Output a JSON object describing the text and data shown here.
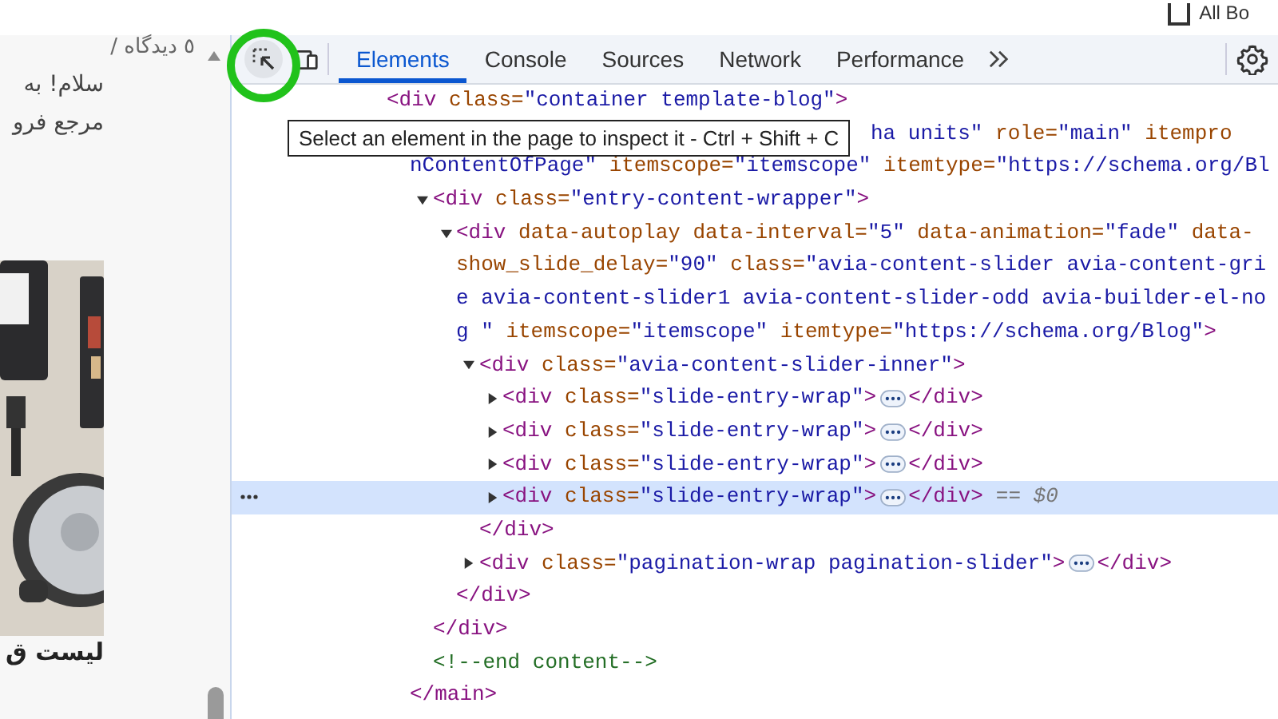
{
  "top_bar": {
    "checkbox": {
      "label": "All Bo",
      "checked": false
    }
  },
  "page": {
    "meta": "٥ دیدگاه /",
    "lines": [
      "سلام! به",
      "مرجع فرو"
    ],
    "heading": "لیست ق"
  },
  "devtools": {
    "tabs": [
      {
        "label": "Elements",
        "selected": true
      },
      {
        "label": "Console",
        "selected": false
      },
      {
        "label": "Sources",
        "selected": false
      },
      {
        "label": "Network",
        "selected": false
      },
      {
        "label": "Performance",
        "selected": false
      }
    ],
    "tooltip": "Select an element in the page to inspect it - Ctrl + Shift + C",
    "tree": [
      {
        "selected": false,
        "lines": [
          [
            {
              "kind": "tag",
              "text": "<div"
            },
            {
              "kind": "attr",
              "text": " class="
            },
            {
              "kind": "value",
              "text": "\"container template-blog\""
            },
            {
              "kind": "tag",
              "text": ">"
            }
          ]
        ],
        "children": [
          {
            "selected": false,
            "covered": true,
            "lines": [
              [
                {
                  "kind": "value",
                  "text": "ha units\""
                },
                {
                  "kind": "attr",
                  "text": " role="
                },
                {
                  "kind": "value",
                  "text": "\"main\""
                },
                {
                  "kind": "attr",
                  "text": " itempro"
                }
              ],
              [
                {
                  "kind": "value",
                  "text": "nContentOfPage\""
                },
                {
                  "kind": "attr",
                  "text": " itemscope="
                },
                {
                  "kind": "value",
                  "text": "\"itemscope\""
                },
                {
                  "kind": "attr",
                  "text": " itemtype="
                },
                {
                  "kind": "value",
                  "text": "\"https://schema.org/Bl"
                }
              ]
            ],
            "children": [
              {
                "selected": false,
                "expanded": true,
                "lines": [
                  [
                    {
                      "kind": "tag",
                      "text": "<div"
                    },
                    {
                      "kind": "attr",
                      "text": " class="
                    },
                    {
                      "kind": "value",
                      "text": "\"entry-content-wrapper\""
                    },
                    {
                      "kind": "tag",
                      "text": ">"
                    }
                  ]
                ],
                "children": [
                  {
                    "selected": false,
                    "expanded": true,
                    "lines": [
                      [
                        {
                          "kind": "tag",
                          "text": "<div"
                        },
                        {
                          "kind": "attr",
                          "text": " data-autoplay data-interval="
                        },
                        {
                          "kind": "value",
                          "text": "\"5\""
                        },
                        {
                          "kind": "attr",
                          "text": " data-animation="
                        },
                        {
                          "kind": "value",
                          "text": "\"fade\""
                        },
                        {
                          "kind": "attr",
                          "text": " data-"
                        }
                      ],
                      [
                        {
                          "kind": "attr",
                          "text": "show_slide_delay="
                        },
                        {
                          "kind": "value",
                          "text": "\"90\""
                        },
                        {
                          "kind": "attr",
                          "text": " class="
                        },
                        {
                          "kind": "value",
                          "text": "\"avia-content-slider avia-content-gri"
                        }
                      ],
                      [
                        {
                          "kind": "value",
                          "text": "e avia-content-slider1 avia-content-slider-odd avia-builder-el-no"
                        }
                      ],
                      [
                        {
                          "kind": "value",
                          "text": "g \""
                        },
                        {
                          "kind": "attr",
                          "text": " itemscope="
                        },
                        {
                          "kind": "value",
                          "text": "\"itemscope\""
                        },
                        {
                          "kind": "attr",
                          "text": " itemtype="
                        },
                        {
                          "kind": "value",
                          "text": "\"https://schema.org/Blog\""
                        },
                        {
                          "kind": "tag",
                          "text": ">"
                        }
                      ]
                    ],
                    "children": [
                      {
                        "selected": false,
                        "expanded": true,
                        "lines": [
                          [
                            {
                              "kind": "tag",
                              "text": "<div"
                            },
                            {
                              "kind": "attr",
                              "text": " class="
                            },
                            {
                              "kind": "value",
                              "text": "\"avia-content-slider-inner\""
                            },
                            {
                              "kind": "tag",
                              "text": ">"
                            }
                          ]
                        ],
                        "children": [
                          {
                            "selected": false,
                            "expanded": false,
                            "lines": [
                              [
                                {
                                  "kind": "tag",
                                  "text": "<div"
                                },
                                {
                                  "kind": "attr",
                                  "text": " class="
                                },
                                {
                                  "kind": "value",
                                  "text": "\"slide-entry-wrap\""
                                },
                                {
                                  "kind": "tag",
                                  "text": ">"
                                }
                              ]
                            ],
                            "close": [
                              {
                                "kind": "tag",
                                "text": "</div>"
                              }
                            ]
                          },
                          {
                            "selected": false,
                            "expanded": false,
                            "lines": [
                              [
                                {
                                  "kind": "tag",
                                  "text": "<div"
                                },
                                {
                                  "kind": "attr",
                                  "text": " class="
                                },
                                {
                                  "kind": "value",
                                  "text": "\"slide-entry-wrap\""
                                },
                                {
                                  "kind": "tag",
                                  "text": ">"
                                }
                              ]
                            ],
                            "close": [
                              {
                                "kind": "tag",
                                "text": "</div>"
                              }
                            ]
                          },
                          {
                            "selected": false,
                            "expanded": false,
                            "lines": [
                              [
                                {
                                  "kind": "tag",
                                  "text": "<div"
                                },
                                {
                                  "kind": "attr",
                                  "text": " class="
                                },
                                {
                                  "kind": "value",
                                  "text": "\"slide-entry-wrap\""
                                },
                                {
                                  "kind": "tag",
                                  "text": ">"
                                }
                              ]
                            ],
                            "close": [
                              {
                                "kind": "tag",
                                "text": "</div>"
                              }
                            ]
                          },
                          {
                            "selected": true,
                            "expanded": false,
                            "lines": [
                              [
                                {
                                  "kind": "tag",
                                  "text": "<div"
                                },
                                {
                                  "kind": "attr",
                                  "text": " class="
                                },
                                {
                                  "kind": "value",
                                  "text": "\"slide-entry-wrap\""
                                },
                                {
                                  "kind": "tag",
                                  "text": ">"
                                }
                              ]
                            ],
                            "close": [
                              {
                                "kind": "tag",
                                "text": "</div>"
                              }
                            ],
                            "suffix": "== $0"
                          }
                        ],
                        "close": [
                          {
                            "kind": "tag",
                            "text": "</div>"
                          }
                        ]
                      },
                      {
                        "selected": false,
                        "expanded": false,
                        "lines": [
                          [
                            {
                              "kind": "tag",
                              "text": "<div"
                            },
                            {
                              "kind": "attr",
                              "text": " class="
                            },
                            {
                              "kind": "value",
                              "text": "\"pagination-wrap pagination-slider\""
                            },
                            {
                              "kind": "tag",
                              "text": ">"
                            }
                          ]
                        ],
                        "close": [
                          {
                            "kind": "tag",
                            "text": "</div>"
                          }
                        ]
                      }
                    ],
                    "close": [
                      {
                        "kind": "tag",
                        "text": "</div>"
                      }
                    ]
                  }
                ],
                "close": [
                  {
                    "kind": "tag",
                    "text": "</div>"
                  }
                ]
              },
              {
                "selected": false,
                "lines": [
                  [
                    {
                      "kind": "comment",
                      "text": "<!--end content-->"
                    }
                  ]
                ]
              }
            ],
            "close": [
              {
                "kind": "tag",
                "text": "</main>"
              }
            ]
          }
        ]
      }
    ]
  }
}
